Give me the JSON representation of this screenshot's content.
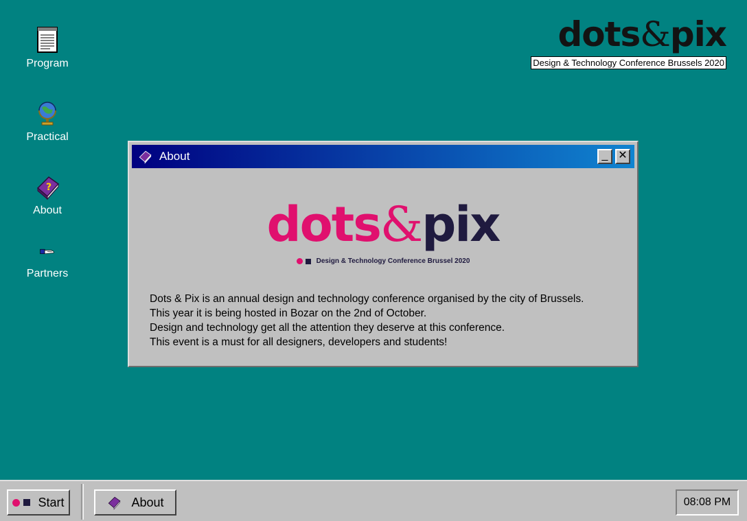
{
  "desktop": {
    "icons": [
      {
        "label": "Program",
        "icon": "notepad-icon"
      },
      {
        "label": "Practical",
        "icon": "globe-icon"
      },
      {
        "label": "About",
        "icon": "help-book-icon"
      },
      {
        "label": "Partners",
        "icon": "handshake-icon"
      }
    ]
  },
  "brand": {
    "logo_left": "dots",
    "logo_amp": "&",
    "logo_right": "pix",
    "subtitle": "Design & Technology Conference Brussels 2020"
  },
  "window": {
    "title": "About",
    "minimize_label": "_",
    "close_label": "✕",
    "logo_left": "dots",
    "logo_amp": "&",
    "logo_right": "pix",
    "logo_tagline": "Design & Technology Conference Brussel 2020",
    "description": [
      "Dots & Pix is an annual design and technology conference organised by the city of Brussels.",
      "This year it is being hosted in Bozar on the 2nd of October.",
      "Design and technology get all the attention they deserve at this conference.",
      "This event is a must for all designers, developers and students!"
    ]
  },
  "taskbar": {
    "start_label": "Start",
    "task_label": "About",
    "clock": "08:08 PM"
  },
  "colors": {
    "desktop": "#018281",
    "pink": "#e0106e",
    "navy": "#1f1a3f"
  }
}
